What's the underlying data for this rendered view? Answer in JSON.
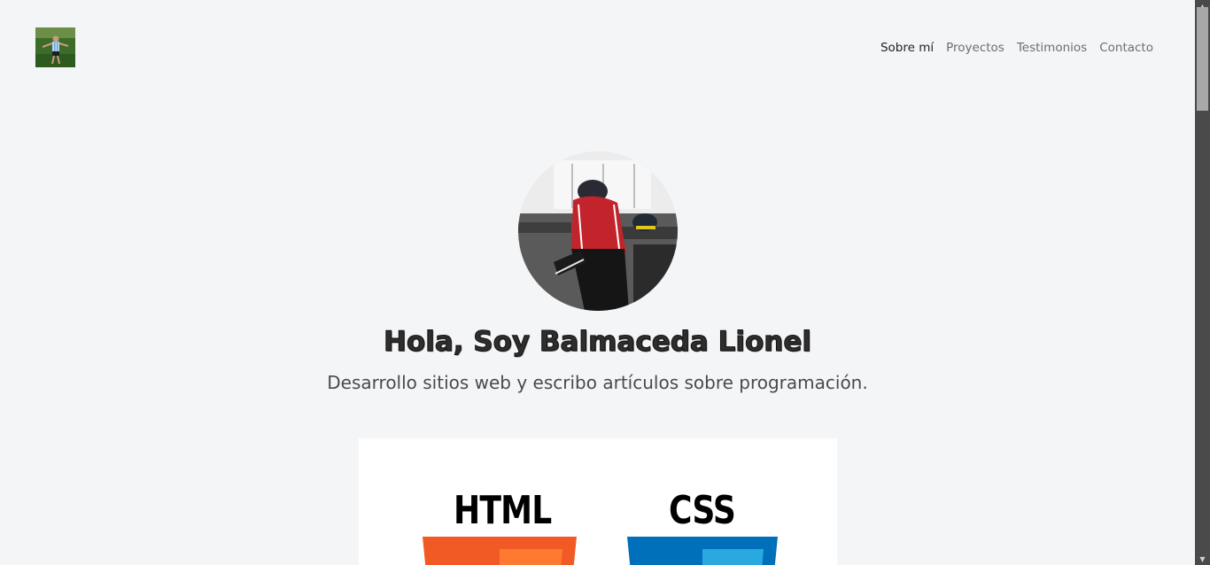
{
  "header": {
    "nav": [
      {
        "label": "Sobre mí",
        "active": true
      },
      {
        "label": "Proyectos",
        "active": false
      },
      {
        "label": "Testimonios",
        "active": false
      },
      {
        "label": "Contacto",
        "active": false
      }
    ]
  },
  "hero": {
    "title": "Hola, Soy Balmaceda Lionel",
    "subtitle": "Desarrollo sitios web y escribo artículos sobre programación."
  },
  "skills": {
    "html_label": "HTML",
    "css_label": "CSS",
    "html_color": "#f15a24",
    "css_color": "#0070ba"
  }
}
